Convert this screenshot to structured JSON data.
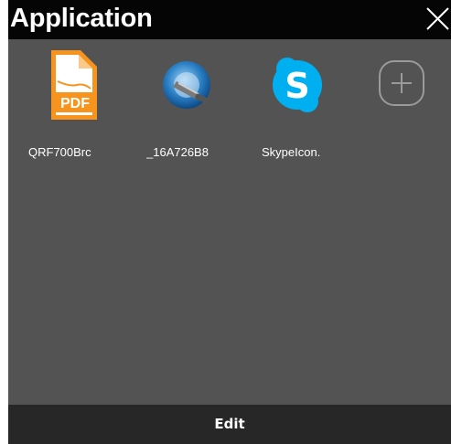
{
  "window": {
    "title": "Application",
    "close_icon": "close-icon"
  },
  "apps": [
    {
      "label": "QRF700Brc",
      "icon": "pdf-file-icon"
    },
    {
      "label": "_16A726B8",
      "icon": "remote-desktop-icon"
    },
    {
      "label": "SkypeIcon.",
      "icon": "skype-icon"
    }
  ],
  "add_button": {
    "icon": "add-circle-icon"
  },
  "footer": {
    "edit_label": "Edit"
  },
  "colors": {
    "titlebar": "#050505",
    "background": "#535353",
    "footer": "#272727",
    "pdf_orange": "#f7941d",
    "skype_blue": "#00aff0"
  }
}
